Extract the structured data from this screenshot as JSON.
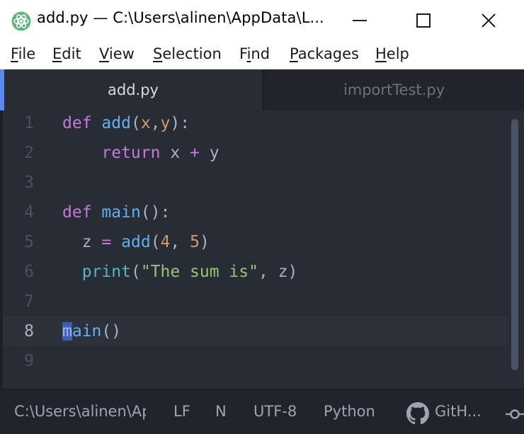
{
  "window": {
    "title": "add.py — C:\\Users\\alinen\\AppData\\L...",
    "app_icon": "atom-icon",
    "controls": [
      "minimize-icon",
      "maximize-icon",
      "close-icon"
    ]
  },
  "menu": {
    "items": [
      {
        "label": "File",
        "mnemonic": "F",
        "rest": "ile"
      },
      {
        "label": "Edit",
        "mnemonic": "E",
        "rest": "dit"
      },
      {
        "label": "View",
        "mnemonic": "V",
        "rest": "iew"
      },
      {
        "label": "Selection",
        "mnemonic": "S",
        "rest": "election"
      },
      {
        "label": "Find",
        "pre": "F",
        "mnemonic": "i",
        "rest": "nd"
      },
      {
        "label": "Packages",
        "mnemonic": "P",
        "rest": "ackages"
      },
      {
        "label": "Help",
        "mnemonic": "H",
        "rest": "elp"
      }
    ]
  },
  "tabs": [
    {
      "label": "add.py",
      "active": true
    },
    {
      "label": "importTest.py",
      "active": false
    }
  ],
  "editor": {
    "line_numbers": [
      "1",
      "2",
      "3",
      "4",
      "5",
      "6",
      "7",
      "8",
      "9"
    ],
    "current_line": "8",
    "tokens": {
      "l1": {
        "kw": "def",
        "fn": "add",
        "open": "(",
        "p1": "x",
        "comma": ",",
        "p2": "y",
        "close": "):"
      },
      "l2": {
        "kw": "return",
        "a": "x",
        "op": "+",
        "b": "y"
      },
      "l4": {
        "kw": "def",
        "fn": "main",
        "rest": "():"
      },
      "l5": {
        "var": "z",
        "op": "=",
        "fn": "add",
        "open": "(",
        "n1": "4",
        "comma": ", ",
        "n2": "5",
        "close": ")"
      },
      "l6": {
        "fn": "print",
        "open": "(",
        "str": "\"The sum is\"",
        "rest": ", z)"
      },
      "l8": {
        "sel": "m",
        "rest": "ain",
        "paren": "()"
      }
    }
  },
  "status": {
    "path": "C:\\Users\\alinen\\AppData\\Local",
    "line_ending": "LF",
    "indicator": "N",
    "encoding": "UTF-8",
    "grammar": "Python",
    "github_icon": "github-icon",
    "github_label": "GitH...",
    "git_icon": "git-commit-icon"
  },
  "colors": {
    "editor_bg": "#282c34",
    "chrome_bg": "#21252b",
    "accent": "#568af2",
    "keyword": "#c678dd",
    "function": "#61afef",
    "number": "#d19a66",
    "string": "#98c379"
  }
}
